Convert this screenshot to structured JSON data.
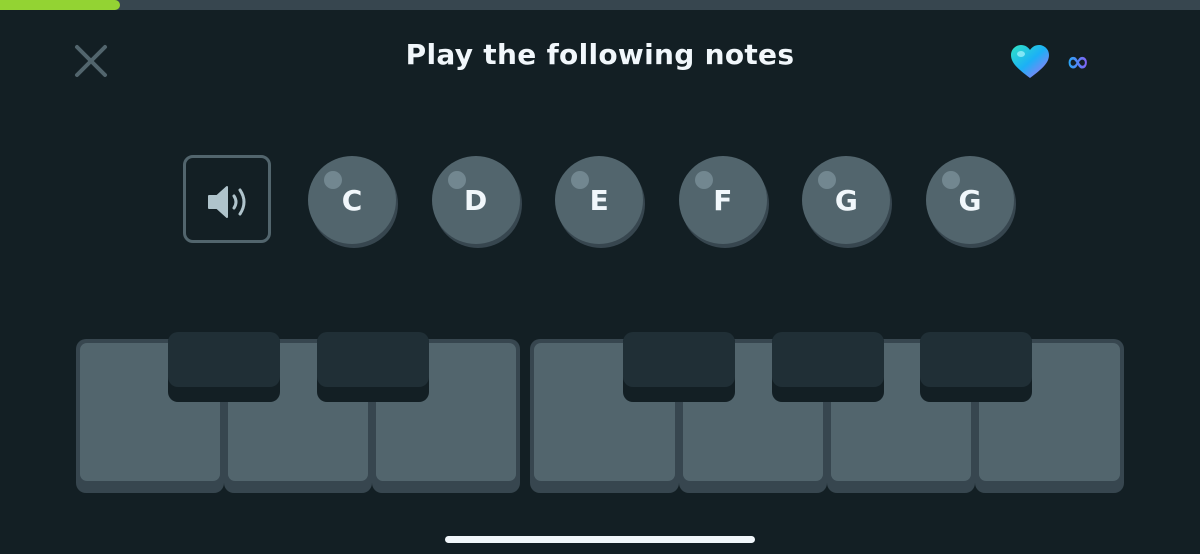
{
  "header": {
    "progress": 0.1,
    "progress_color": "#93d333",
    "close_icon": "close-icon",
    "title": "Play the following notes",
    "hearts": {
      "icon": "heart-icon",
      "value": "∞"
    }
  },
  "prompt": {
    "speaker_icon": "speaker-icon",
    "notes": [
      "C",
      "D",
      "E",
      "F",
      "G",
      "G"
    ]
  },
  "piano": {
    "white_keys": 7,
    "black_keys": 5,
    "white_key_color": "#52656d",
    "black_key_color": "#202f36"
  }
}
